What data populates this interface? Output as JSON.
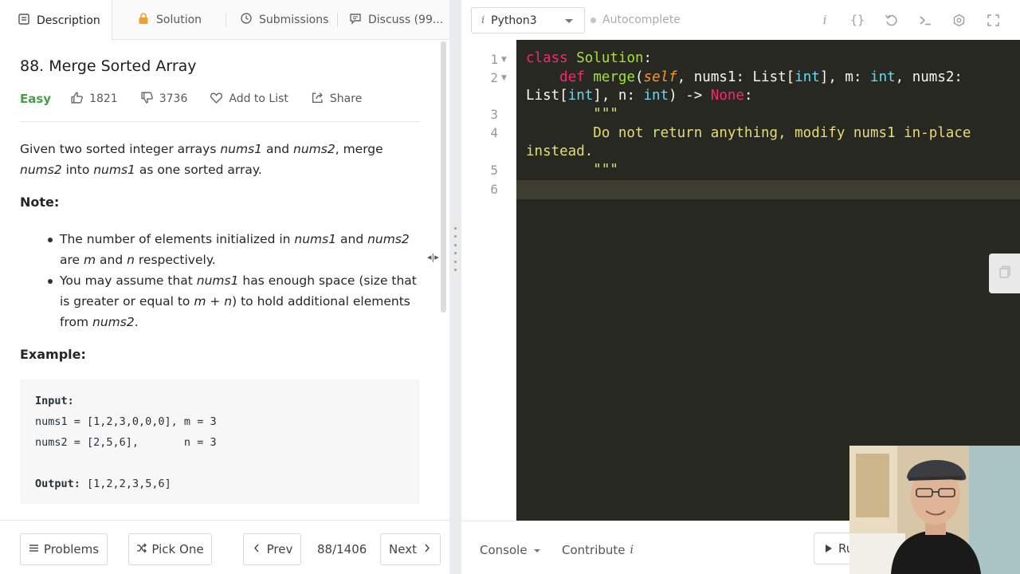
{
  "tabs": [
    {
      "label": "Description",
      "icon": "document-icon",
      "active": true
    },
    {
      "label": "Solution",
      "icon": "lock-icon",
      "active": false
    },
    {
      "label": "Submissions",
      "icon": "clock-icon",
      "active": false
    },
    {
      "label": "Discuss (99...",
      "icon": "chat-icon",
      "active": false
    }
  ],
  "problem": {
    "title": "88. Merge Sorted Array",
    "difficulty": "Easy",
    "likes": "1821",
    "dislikes": "3736",
    "add_to_list": "Add to List",
    "share": "Share",
    "note_heading": "Note:",
    "example_heading": "Example:",
    "example_input_label": "Input:",
    "example_line1": "nums1 = [1,2,3,0,0,0], m = 3",
    "example_line2": "nums2 = [2,5,6],       n = 3",
    "example_output_label": "Output:",
    "example_output": "[1,2,2,3,5,6]"
  },
  "footer_left": {
    "problems": "Problems",
    "pick_one": "Pick One",
    "prev": "Prev",
    "page": "88/1406",
    "next": "Next"
  },
  "editor": {
    "language": "Python3",
    "language_icon": "i",
    "autocomplete": "Autocomplete",
    "line_numbers": [
      "1",
      "2",
      "3",
      "4",
      "5",
      "6"
    ]
  },
  "footer_right": {
    "console": "Console",
    "contribute": "Contribute",
    "contribute_icon": "i",
    "run": "Run"
  },
  "colors": {
    "accent_easy": "#43a047",
    "editor_bg": "#272822"
  }
}
